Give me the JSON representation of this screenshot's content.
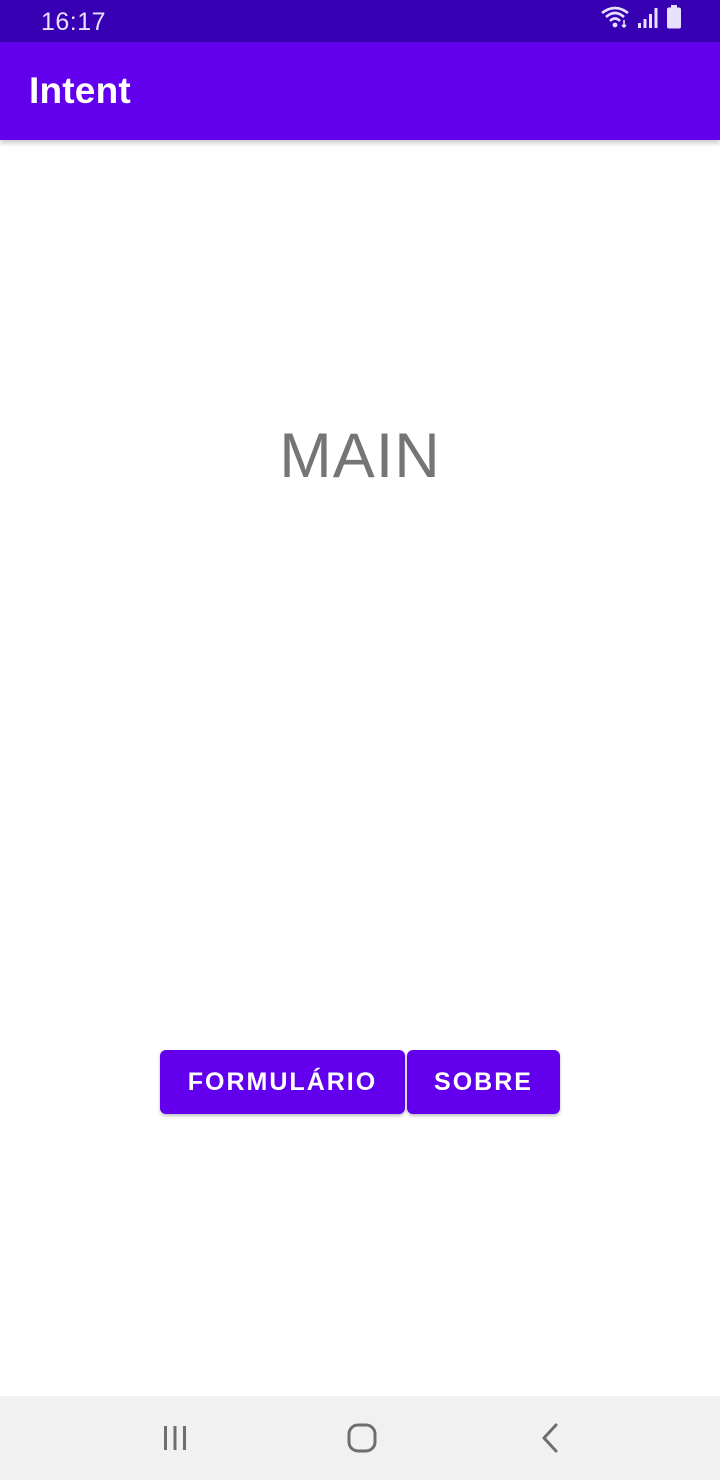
{
  "status_bar": {
    "time": "16:17",
    "icons": [
      "wifi-icon",
      "signal-icon",
      "battery-icon"
    ]
  },
  "app_bar": {
    "title": "Intent",
    "color": "#6200ee"
  },
  "main": {
    "label": "MAIN"
  },
  "buttons": {
    "formulario": "FORMULÁRIO",
    "sobre": "SOBRE"
  },
  "nav_bar": {
    "icons": [
      "recents-icon",
      "home-icon",
      "back-icon"
    ]
  },
  "colors": {
    "status_bar": "#3700b3",
    "primary": "#6200ee",
    "label_text": "#757575",
    "nav_bar": "#f1f1f1"
  }
}
